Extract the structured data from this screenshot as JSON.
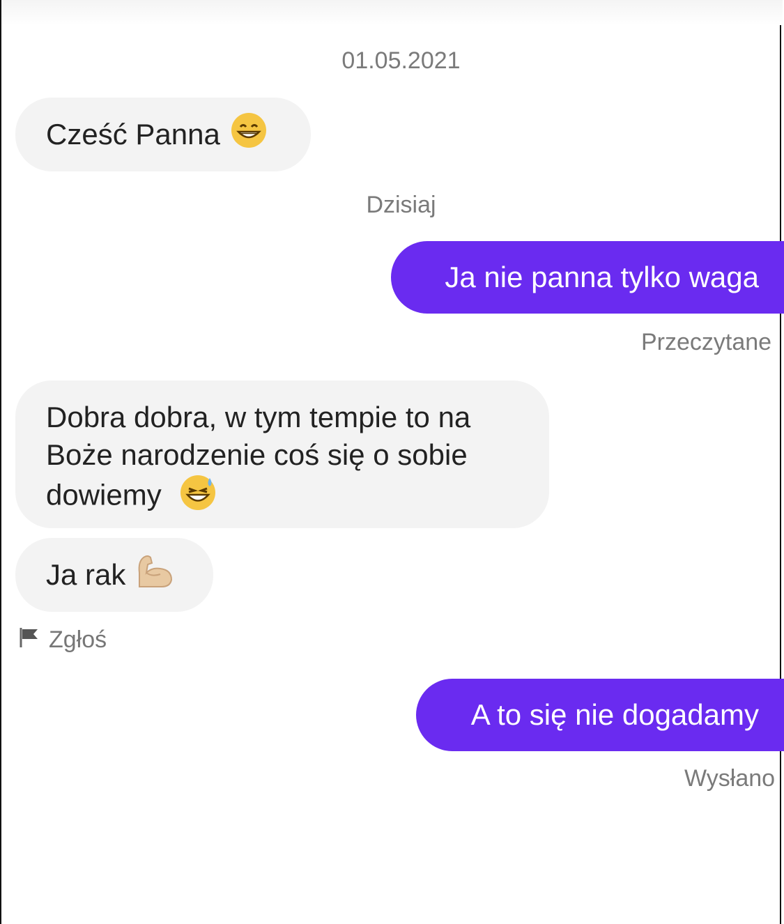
{
  "conversation": {
    "date_separator": "01.05.2021",
    "today_separator": "Dzisiaj",
    "messages": [
      {
        "direction": "incoming",
        "text": "Cześć Panna",
        "emoji": "grinning-face-icon"
      },
      {
        "direction": "outgoing",
        "text": "Ja nie panna tylko waga",
        "status": "Przeczytane"
      },
      {
        "direction": "incoming",
        "lines": [
          "Dobra dobra, w tym tempie to na",
          "Boże narodzenie coś się o sobie",
          "dowiemy"
        ],
        "emoji": "grinning-sweat-face-icon"
      },
      {
        "direction": "incoming",
        "text": "Ja rak",
        "emoji": "flexed-biceps-icon"
      },
      {
        "direction": "outgoing",
        "text": "A to się nie dogadamy",
        "status": "Wysłano"
      }
    ],
    "report_label": "Zgłoś"
  },
  "colors": {
    "outgoing_bubble": "#6a2bf0",
    "incoming_bubble": "#f3f3f3",
    "muted_text": "#7a7a7a"
  }
}
